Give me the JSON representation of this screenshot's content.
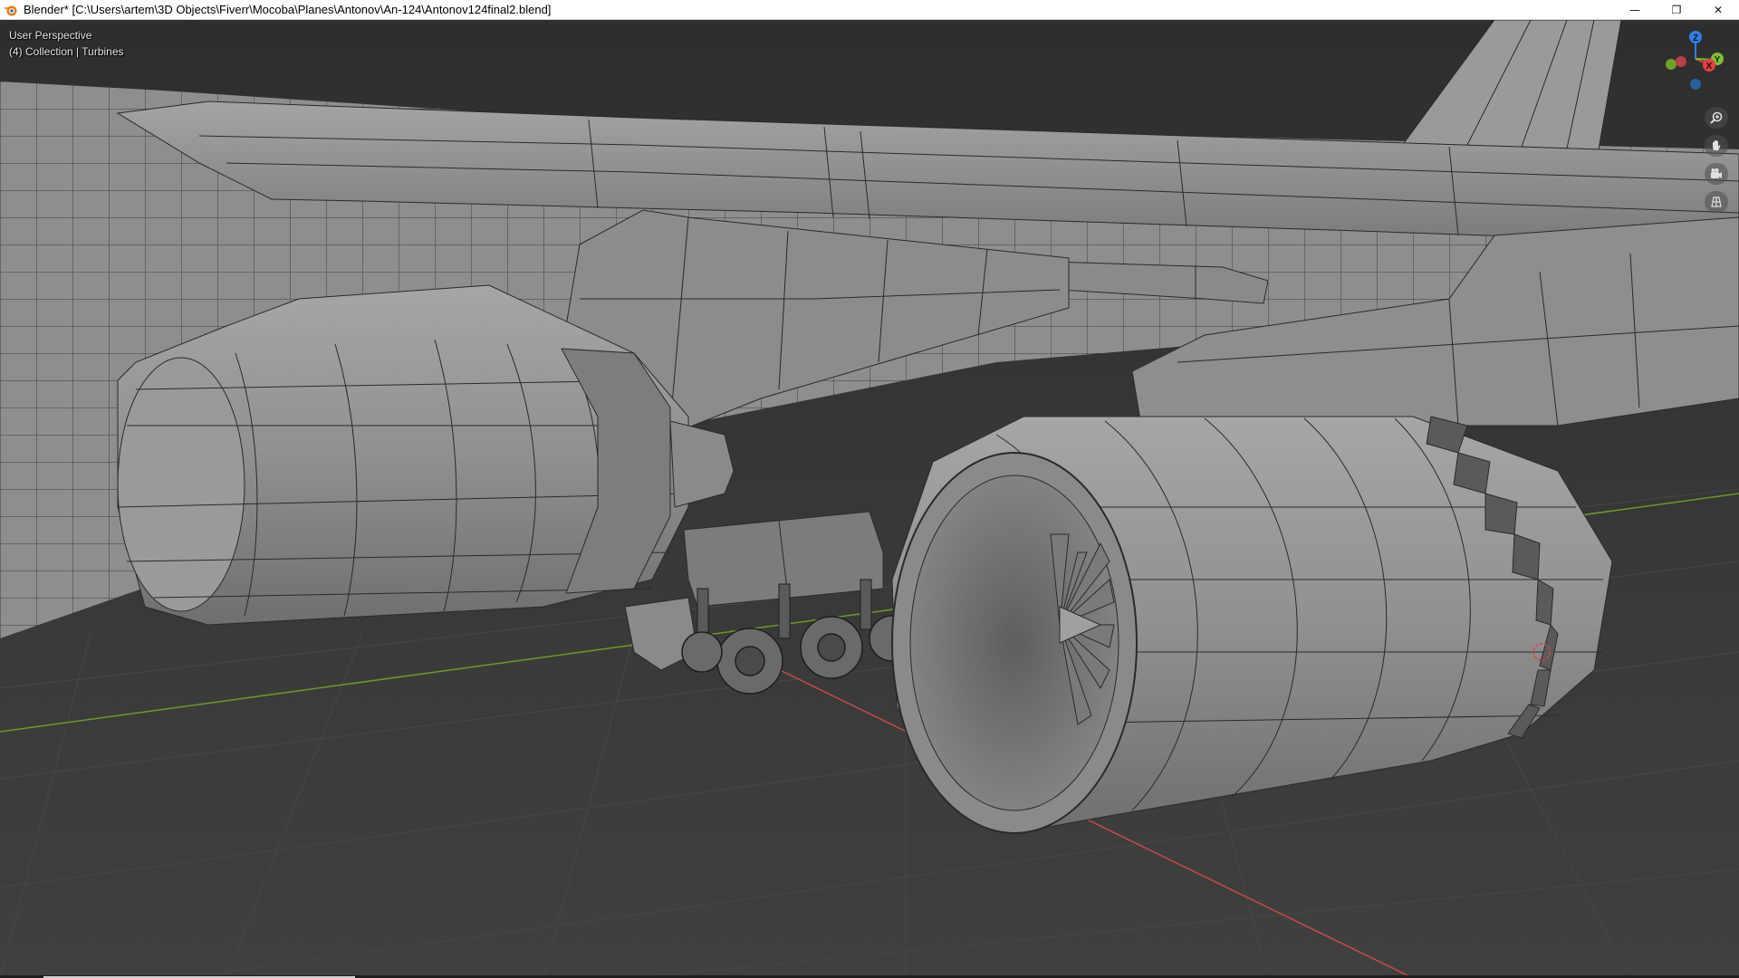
{
  "window": {
    "title": "Blender* [C:\\Users\\artem\\3D Objects\\Fiverr\\Mocoba\\Planes\\Antonov\\An-124\\Antonov124final2.blend]",
    "controls": {
      "minimize": "—",
      "restore": "❐",
      "close": "✕"
    }
  },
  "viewport": {
    "view_name": "User Perspective",
    "collection_info": "(4) Collection | Turbines"
  },
  "gizmo": {
    "axes": [
      {
        "axis": "Z",
        "color": "#2f7fe8"
      },
      {
        "axis": "X",
        "color": "#e0404a"
      },
      {
        "axis": "Y",
        "color": "#7fbf2f"
      }
    ]
  },
  "nav_tools": [
    {
      "icon": "zoom-icon"
    },
    {
      "icon": "hand-pan-icon"
    },
    {
      "icon": "camera-icon"
    },
    {
      "icon": "grid-ortho-icon"
    }
  ],
  "colors": {
    "grid_background": "#3a3a3a",
    "mesh_surface": "#8f8f8f",
    "wire": "#2a2a2a",
    "axis_x": "#c84a4a",
    "axis_y": "#6a9a2a"
  }
}
